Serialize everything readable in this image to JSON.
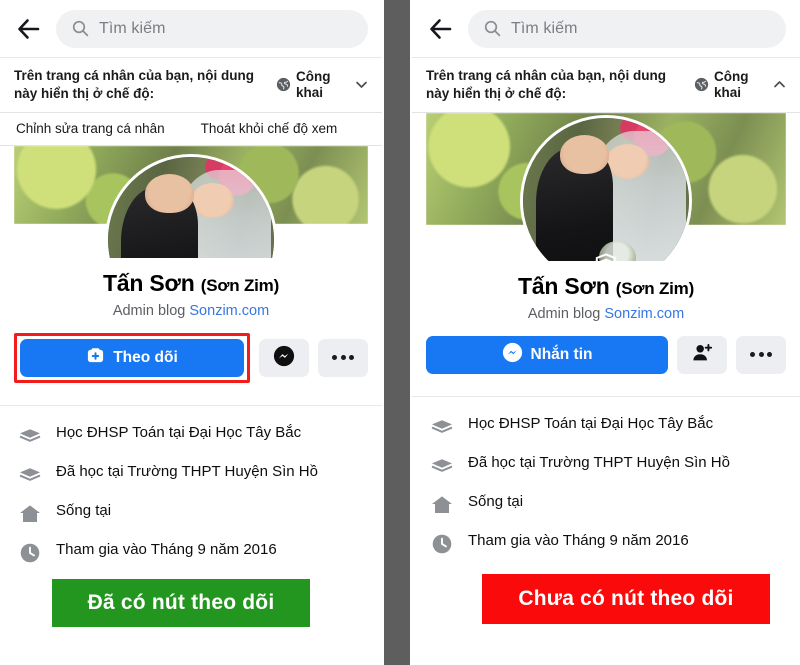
{
  "meta": {
    "accent_blue": "#1877f2",
    "link_blue": "#3578e5",
    "callout_green": "#22961f",
    "callout_red": "#fa0a0a",
    "highlight_red": "#f41b1b",
    "gutter_gray": "#5e5e5e"
  },
  "search": {
    "placeholder": "Tìm kiếm",
    "back_icon": "back-arrow-icon",
    "search_icon": "search-icon"
  },
  "privacy": {
    "notice": "Trên trang cá nhân của bạn, nội dung này hiển thị ở chế độ:",
    "value": "Công khai",
    "globe_icon": "globe-icon",
    "chevron_left": "chevron-down-icon",
    "chevron_right": "chevron-up-icon"
  },
  "view_tools": {
    "edit_profile": "Chỉnh sửa trang cá nhân",
    "exit_view": "Thoát khỏi chế độ xem"
  },
  "profile": {
    "name": "Tấn Sơn",
    "alias": "(Sơn Zim)",
    "subtitle_prefix": "Admin blog ",
    "subtitle_link": "Sonzim.com",
    "shield_badge_icon": "shield-icon"
  },
  "left_actions": {
    "primary_label": "Theo dõi",
    "primary_icon": "follow-plus-icon",
    "messenger_icon": "messenger-icon",
    "more_icon": "more-dots-icon"
  },
  "right_actions": {
    "primary_label": "Nhắn tin",
    "primary_icon": "messenger-icon",
    "add_friend_icon": "add-friend-icon",
    "more_icon": "more-dots-icon"
  },
  "info": [
    {
      "icon": "graduation-cap-icon",
      "text": "Học ĐHSP Toán tại Đại Học Tây Bắc"
    },
    {
      "icon": "graduation-cap-icon",
      "text": "Đã học tại Trường THPT Huyện Sìn Hồ"
    },
    {
      "icon": "home-icon",
      "text": "Sống tại"
    },
    {
      "icon": "clock-icon",
      "text": "Tham gia vào Tháng 9 năm 2016"
    }
  ],
  "callouts": {
    "left": "Đã có nút theo dõi",
    "right": "Chưa có nút theo dõi"
  }
}
